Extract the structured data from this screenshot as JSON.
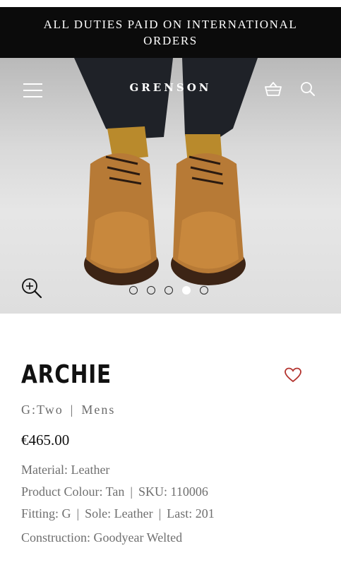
{
  "promo_banner": {
    "text": "ALL DUTIES PAID ON INTERNATIONAL ORDERS"
  },
  "header": {
    "brand": "GRENSON",
    "icons": {
      "menu": "hamburger-menu-icon",
      "basket": "basket-icon",
      "search": "search-icon"
    }
  },
  "gallery": {
    "zoom_icon": "zoom-in-icon",
    "slide_count": 5,
    "active_slide": 4
  },
  "product": {
    "name": "ARCHIE",
    "fit_label": "G:Two",
    "separator": "|",
    "category": "Mens",
    "price": "€465.00",
    "material": "Material: Leather",
    "colour": "Product Colour: Tan",
    "sku": "SKU: 110006",
    "fitting": "Fitting: G",
    "sole": "Sole: Leather",
    "last": "Last: 201",
    "construction": "Construction: Goodyear Welted"
  },
  "colors": {
    "banner_bg": "#0b0b0b",
    "accent_heart": "#b3332e",
    "muted_text": "#6f6f6f"
  }
}
